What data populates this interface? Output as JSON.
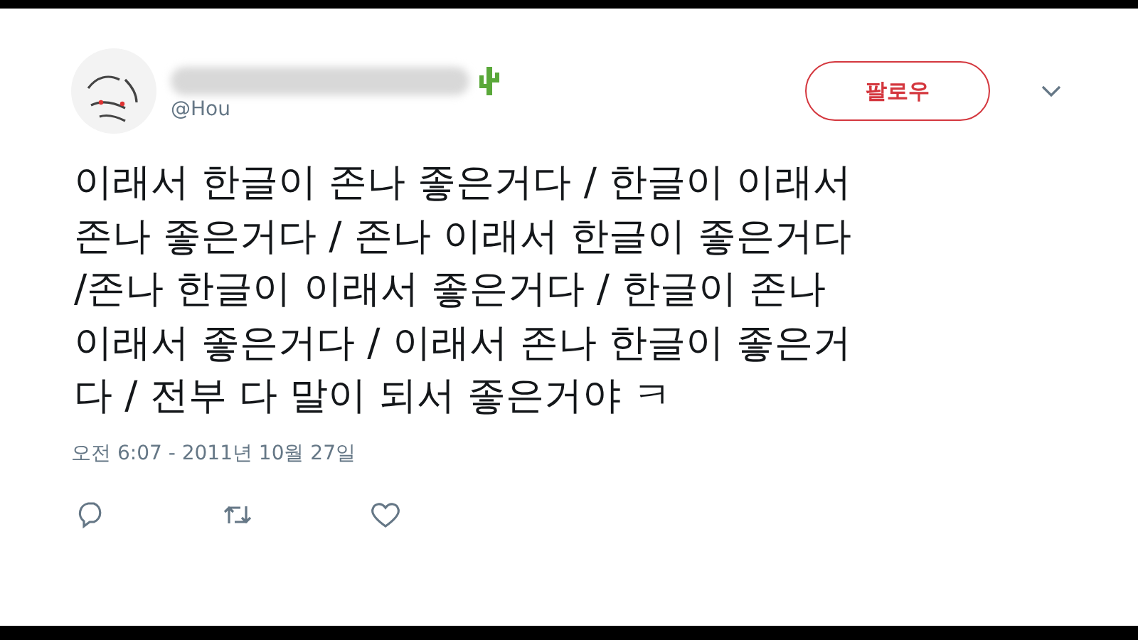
{
  "tweet": {
    "handle": "@Hou",
    "follow_button": "팔로우",
    "text_lines": [
      "이래서 한글이 존나 좋은거다 / 한글이 이래서",
      "존나 좋은거다 / 존나 이래서 한글이 좋은거다",
      "/존나 한글이 이래서 좋은거다 / 한글이 존나",
      "이래서 좋은거다 / 이래서 존나 한글이 좋은거",
      "다 / 전부 다 말이 되서 좋은거야 ㅋ"
    ],
    "timestamp": "오전 6:07 - 2011년 10월 27일"
  }
}
